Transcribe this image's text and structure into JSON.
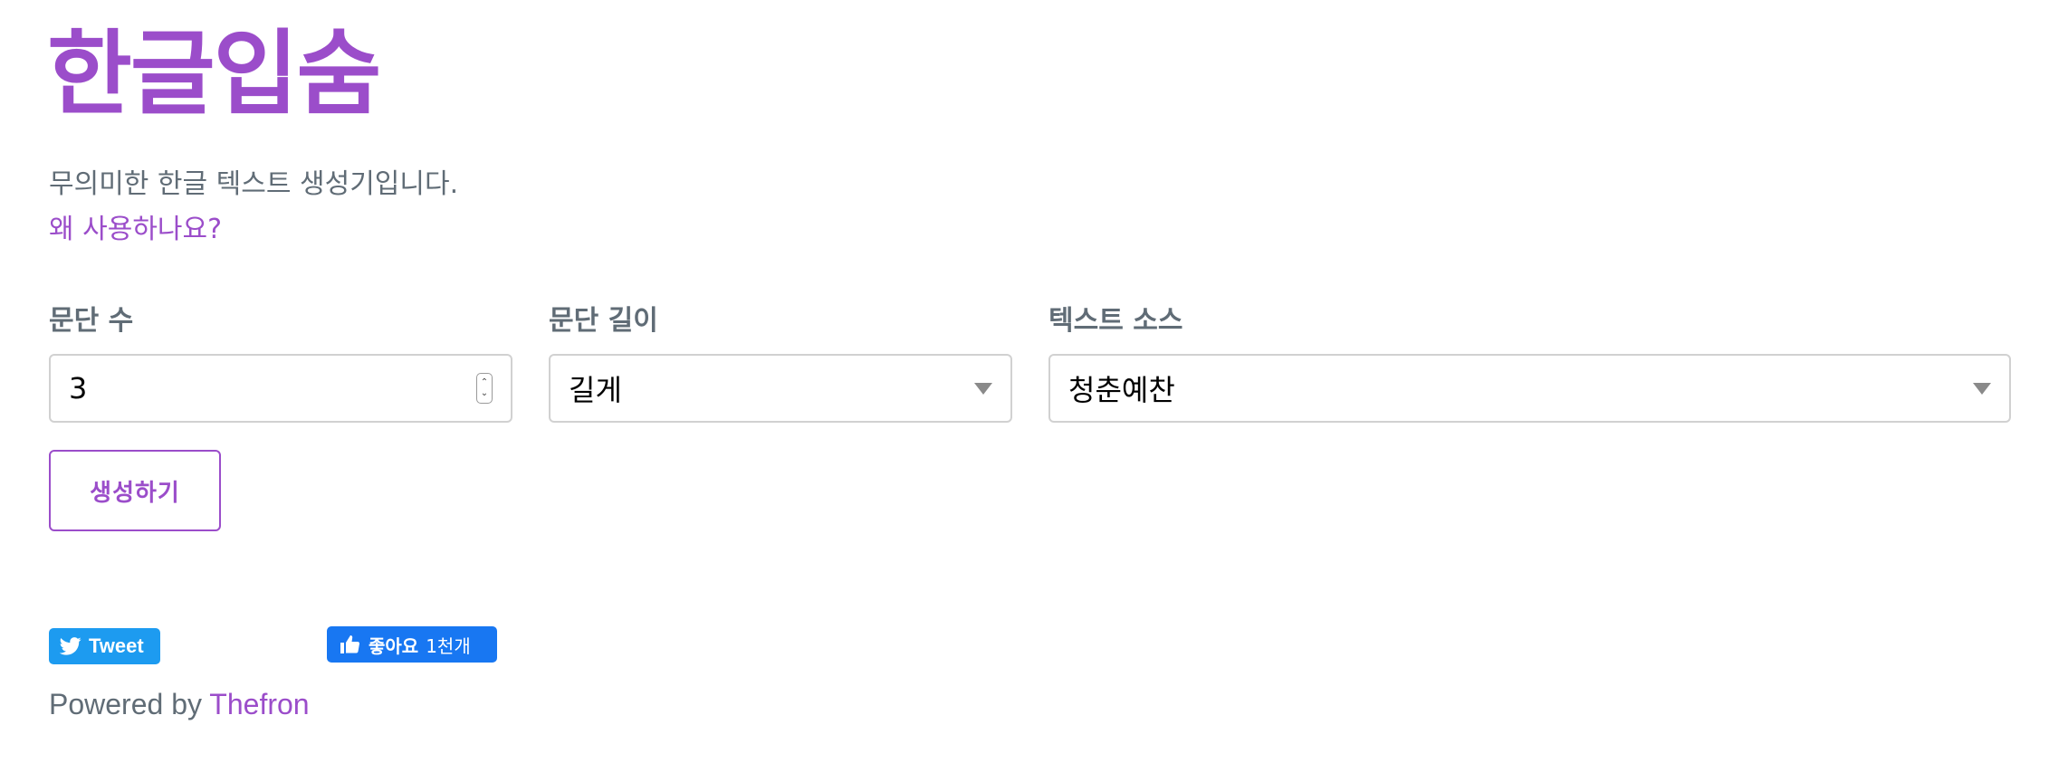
{
  "page": {
    "title": "한글입숨",
    "subtitle": "무의미한 한글 텍스트 생성기입니다.",
    "why_link": "왜 사용하나요?"
  },
  "form": {
    "paragraph_count": {
      "label": "문단 수",
      "value": "3"
    },
    "paragraph_length": {
      "label": "문단 길이",
      "value": "길게"
    },
    "text_source": {
      "label": "텍스트 소스",
      "value": "청춘예찬"
    },
    "generate_label": "생성하기"
  },
  "social": {
    "tweet_label": "Tweet",
    "like_label": "좋아요",
    "like_count": "1천개"
  },
  "footer": {
    "powered_prefix": "Powered by",
    "powered_link": "Thefron"
  },
  "colors": {
    "accent": "#9b4dca",
    "text": "#606c76",
    "twitter": "#1d9bf0",
    "facebook": "#1877f2"
  }
}
